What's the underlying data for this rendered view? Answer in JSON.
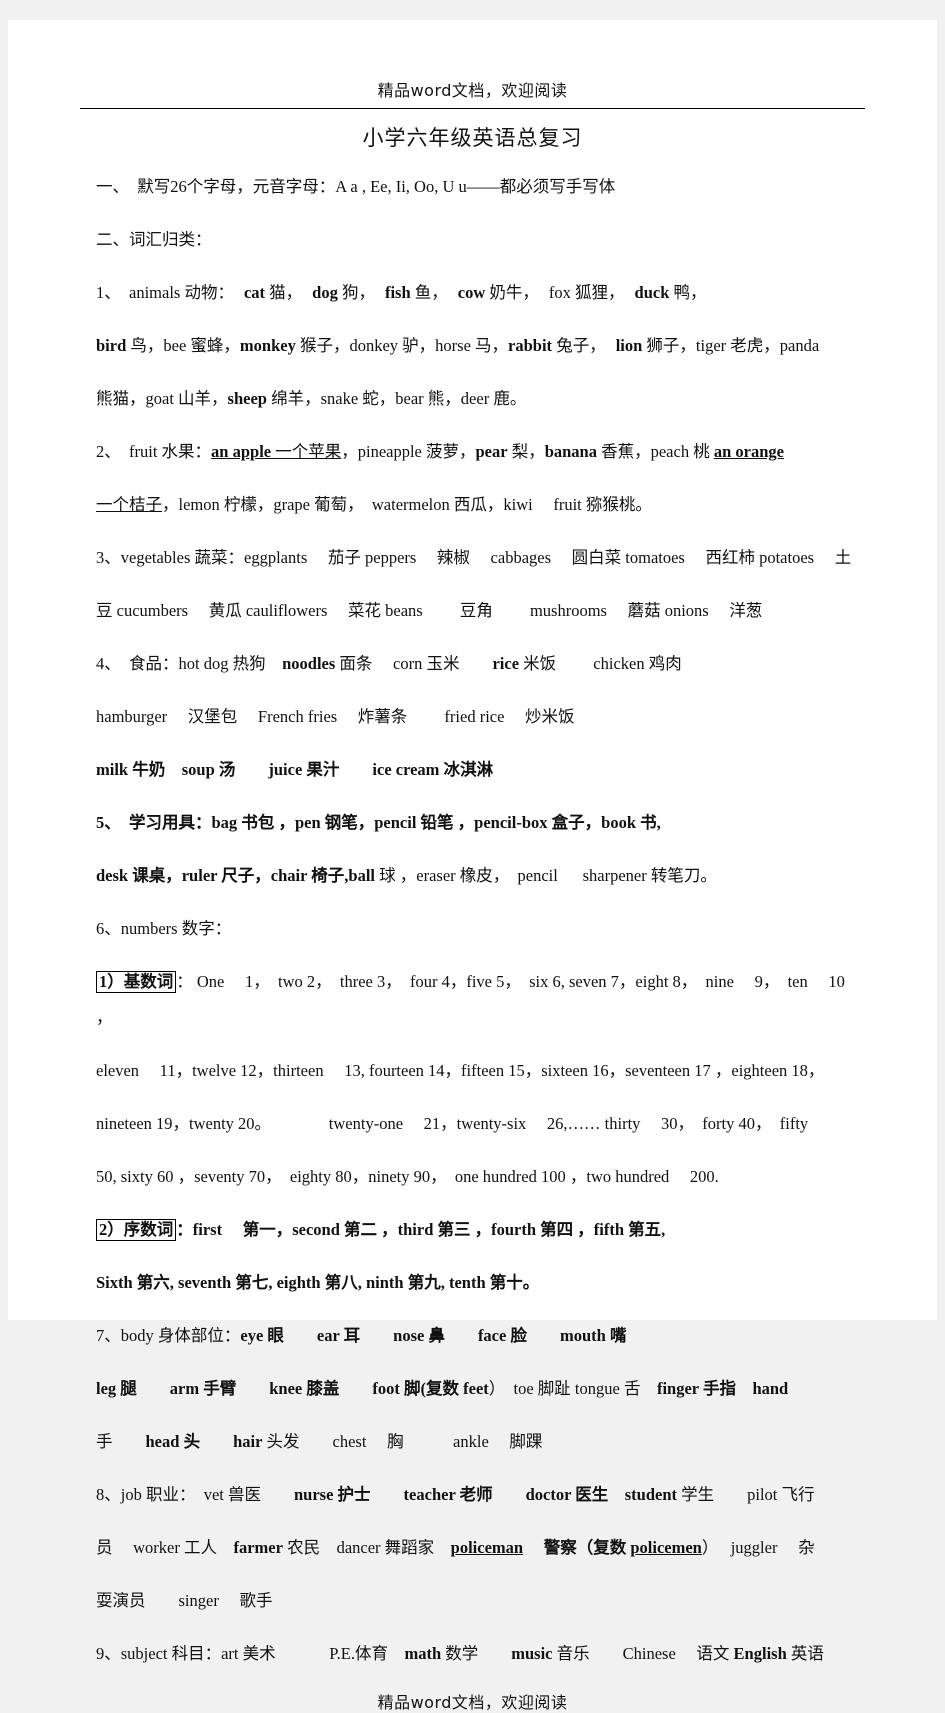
{
  "document": {
    "header_note": "精品word文档，欢迎阅读",
    "title": "小学六年级英语总复习",
    "footer_note": "精品word文档，欢迎阅读"
  },
  "sections": {
    "item1": "一、　默写26个字母，元音字母：A a , Ee, Ii, Oo, U u——都必须写手写体",
    "item2": "二、词汇归类：",
    "animals": {
      "lead": "1、　animals 动物：",
      "line1_b1": "cat",
      "line1_t1": " 猫，",
      "line1_b2": "dog",
      "line1_t2": " 狗，",
      "line1_b3": "fish",
      "line1_t3": " 鱼，",
      "line1_b4": "cow",
      "line1_t4": " 奶牛，",
      "line1_n1": "fox 狐狸，",
      "line1_b5": "duck",
      "line1_t5": " 鸭，",
      "line2_b1": "bird",
      "line2_t1": " 鸟，bee 蜜蜂，",
      "line2_b2": "monkey",
      "line2_t2": " 猴子，donkey 驴，horse 马，",
      "line2_b3": "rabbit",
      "line2_t3": " 兔子，",
      "line2_b4": "lion",
      "line2_t4": " 狮子，tiger 老虎，panda",
      "line3": "熊猫，goat 山羊，",
      "line3_b1": "sheep",
      "line3_t1": " 绵羊，snake 蛇，bear 熊，deer 鹿。"
    },
    "fruit": {
      "lead": "2、　fruit 水果：",
      "bu1": "an  apple",
      "t1": " 一个苹果",
      "t2": "，pineapple 菠萝，",
      "b1": "pear",
      "t3": " 梨，",
      "b2": "banana",
      "t4": " 香蕉，peach 桃 ",
      "bu2": "an  orange",
      "bu3": "一个桔子",
      "t5": "，lemon 柠檬，grape 葡萄，　watermelon 西瓜，kiwi 　fruit 猕猴桃。"
    },
    "vegetables": {
      "line1": "3、vegetables 蔬菜：eggplants 　茄子 peppers 　辣椒　 cabbages 　圆白菜 tomatoes 　西红柿 potatoes 　土",
      "line2": "豆 cucumbers 　黄瓜 cauliflowers 　菜花 beans 　　豆角　　 mushrooms 　蘑菇 onions 　洋葱"
    },
    "food": {
      "line1_lead": "4、　食品：hot dog 热狗　",
      "line1_b1": "noodles",
      "line1_t1": " 面条　 corn 玉米　　",
      "line1_b2": "rice",
      "line1_t2": " 米饭　　 chicken 鸡肉",
      "line2": "hamburger 　汉堡包　 French fries 　炸薯条　　 fried rice 　炒米饭",
      "line3_b1": "milk",
      "line3_t1": " 牛奶　",
      "line3_b2": "soup",
      "line3_t2": " 汤　　",
      "line3_b3": "juice",
      "line3_t3": " 果汁　　",
      "line3_b4": "ice cream",
      "line3_t4": " 冰淇淋"
    },
    "school": {
      "line1_lead": "5、　学习用具：",
      "line1_b1": "bag",
      "line1_t1": " 书包 ，",
      "line1_b2": "pen",
      "line1_t2": " 钢笔，",
      "line1_b3": "pencil",
      "line1_t3": " 铅笔 ，",
      "line1_b4": "pencil-box",
      "line1_t4": " 盒子，",
      "line1_b5": "book",
      "line1_t5": " 书,",
      "line2_b1": "desk",
      "line2_t1": " 课桌，",
      "line2_b2": "ruler",
      "line2_t2": " 尺子，",
      "line2_b3": "chair",
      "line2_t3": " 椅子,",
      "line2_b4": "ball",
      "line2_t4": " 球 ，eraser 橡皮，　pencil 　 sharpener 转笔刀。"
    },
    "numbers_head": "6、numbers 数字：",
    "cardinals": {
      "label": "1）基数词",
      "line1": "： One 　1，　two 2，　three 3，　four 4，five 5，　six 6, seven 7，eight 8，　nine 　9，　ten 　10 ，",
      "line2": "eleven 　11，twelve 12，thirteen 　13, fourteen 14，fifteen 15，sixteen 16，seventeen 17 ，eighteen 18，",
      "line3": "nineteen 19，twenty 20。　　　　twenty-one 　21，twenty-six 　26,…… thirty 　30，　forty 40，　fifty",
      "line4": "50, sixty 60 ，seventy 70，　eighty 80，ninety 90，　one hundred 100 ，two hundred 　200."
    },
    "ordinals": {
      "label": "2）序数词",
      "line1": "：first 　第一，second 第二 ，third 第三 ，fourth 第四 ，fifth 第五,",
      "line2": "Sixth 第六, seventh 第七, eighth 第八, ninth 第九, tenth 第十。"
    },
    "body": {
      "line1_lead": "7、body 身体部位：",
      "line1_b1": "eye",
      "line1_t1": " 眼　　",
      "line1_b2": "ear",
      "line1_t2": " 耳　　",
      "line1_b3": "nose",
      "line1_t3": " 鼻　　",
      "line1_b4": "face",
      "line1_t4": " 脸　　",
      "line1_b5": "mouth",
      "line1_t5": " 嘴",
      "line2_b1": "leg",
      "line2_t1": " 腿　　",
      "line2_b2": "arm",
      "line2_t2": " 手臂　　",
      "line2_b3": "knee",
      "line2_t3": " 膝盖　　",
      "line2_b4": "foot",
      "line2_t4": " 脚(复数 ",
      "line2_b5": "feet",
      "line2_t5": "）　toe 脚趾 tongue 舌　",
      "line2_b6": "finger",
      "line2_t6": " 手指　",
      "line2_b7": "hand",
      "line3_t1": "手　　",
      "line3_b1": "head",
      "line3_t2": " 头　　",
      "line3_b2": "hair",
      "line3_t3": " 头发　　chest 　胸　　　ankle 　脚踝"
    },
    "job": {
      "line1_lead": "8、job 职业：　vet 兽医　　",
      "line1_b1": "nurse",
      "line1_t1": " 护士　　",
      "line1_b2": "teacher",
      "line1_t2": " 老师　　",
      "line1_b3": "doctor",
      "line1_t3": " 医生　",
      "line1_b4": "student",
      "line1_t4": " 学生　　pilot 飞行",
      "line2_t1": "员　 worker 工人　",
      "line2_b1": "farmer",
      "line2_t2": " 农民　dancer 舞蹈家　",
      "line2_b2": "policeman",
      "line2_t3": " 　警察（复数 ",
      "line2_b3": "policemen",
      "line2_t4": "）　 juggler 　杂",
      "line3": "耍演员　　singer 　歌手"
    },
    "subject": {
      "lead": "9、subject 科目：art 美术　　　 P.E.体育　",
      "b1": "math",
      "t1": " 数学　　",
      "b2": "music",
      "t2": " 音乐　　Chinese 　语文 ",
      "b3": "English",
      "t3": " 英语"
    }
  }
}
